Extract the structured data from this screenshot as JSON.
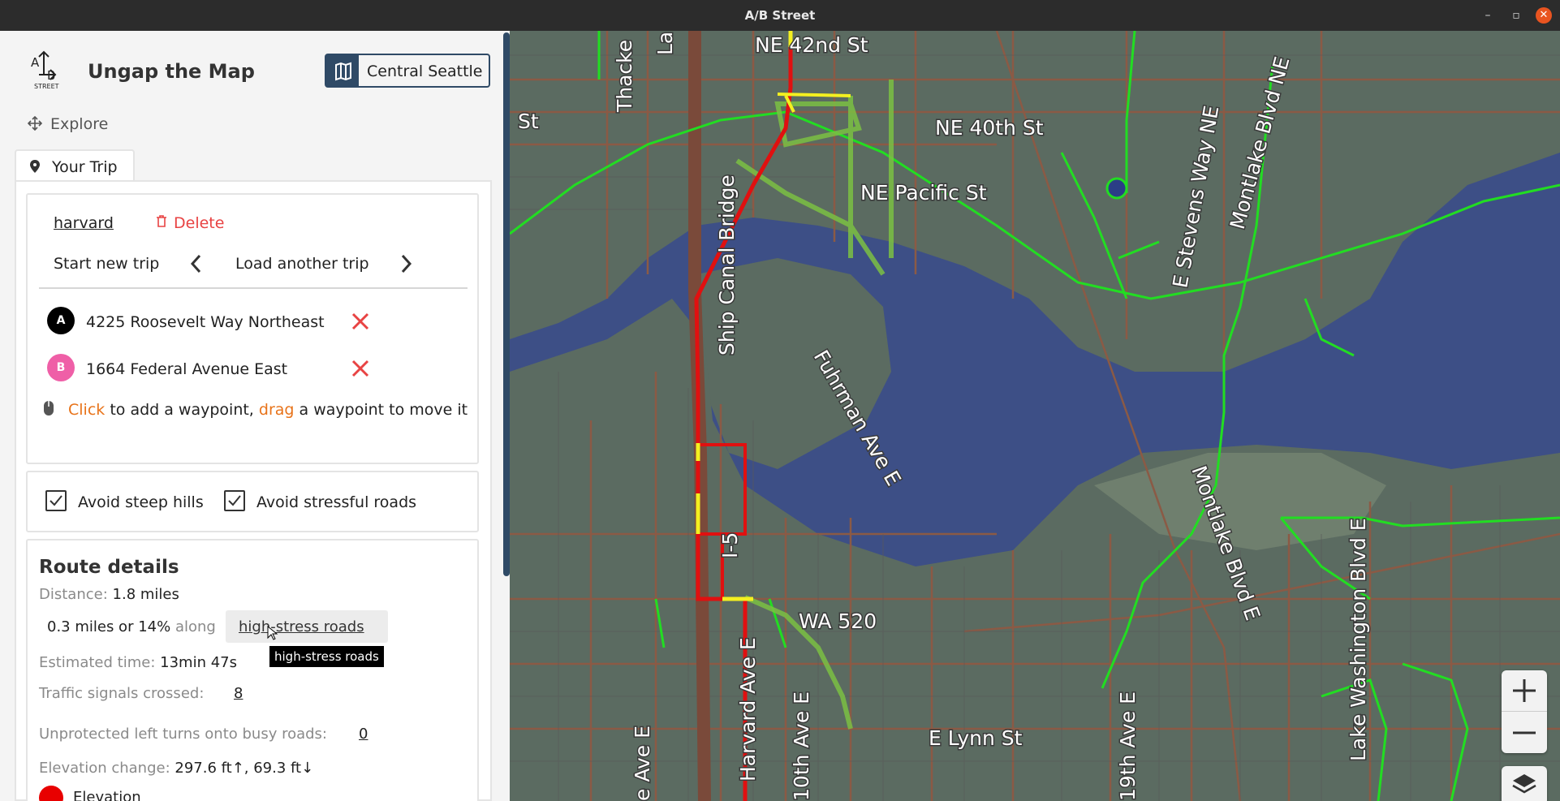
{
  "window": {
    "title": "A/B Street",
    "minimize": "–",
    "restore": "▫",
    "close": "✕"
  },
  "header": {
    "logo_text": "A/B",
    "logo_sub": "STREET",
    "app_name": "Ungap the Map",
    "region_button": "Central Seattle",
    "explore": "Explore",
    "tab_your_trip": "Your Trip"
  },
  "trip": {
    "name": "harvard",
    "delete": "Delete",
    "start_new": "Start new trip",
    "load_another": "Load another trip",
    "waypoints": [
      {
        "badge": "A",
        "label": "4225 Roosevelt Way Northeast",
        "color": "#000000"
      },
      {
        "badge": "B",
        "label": "1664 Federal Avenue East",
        "color": "#ef5fa7"
      }
    ],
    "hint_click": "Click",
    "hint_mid": "to add a waypoint,",
    "hint_drag": "drag",
    "hint_end": "a waypoint to move it"
  },
  "options": {
    "avoid_hills": "Avoid steep hills",
    "avoid_stress": "Avoid stressful roads"
  },
  "route": {
    "title": "Route details",
    "distance_label": "Distance:",
    "distance_value": "1.8 miles",
    "stress_amount": "0.3 miles or 14%",
    "stress_along": "along",
    "stress_link": "high-stress roads",
    "tooltip": "high-stress roads",
    "time_label": "Estimated time:",
    "time_value": "13min 47s",
    "signals_label": "Traffic signals crossed:",
    "signals_value": "8",
    "left_turns_label": "Unprotected left turns onto busy roads:",
    "left_turns_value": "0",
    "elevation_label": "Elevation change:",
    "elevation_value": "297.6 ft↑, 69.3 ft↓",
    "elevation_legend": "Elevation"
  },
  "map_labels": {
    "ne42": "NE 42nd St",
    "ne40": "NE 40th St",
    "pacific": "NE Pacific St",
    "st": "St",
    "thacke": "Thacke",
    "la": "La",
    "ship_canal": "Ship Canal Bridge",
    "stevens": "E Stevens Way NE",
    "montlake_ne": "Montlake Blvd NE",
    "fuhrman": "Fuhrman Ave E",
    "i5": "I-5",
    "montlake_e": "Montlake Blvd E",
    "wa520": "WA 520",
    "lake_wash": "Lake Washington Blvd E",
    "harvard": "Harvard Ave E",
    "tenth": "10th Ave E",
    "e_ave": "e Ave E",
    "nineteenth": "19th Ave E",
    "lynn": "E Lynn St"
  },
  "colors": {
    "panel_bg": "#f4f4f4",
    "accent": "#e8731a",
    "route_red": "#e01010",
    "route_yellow": "#f4f020",
    "bike_green": "#22dd22",
    "water": "#3d4f86",
    "land": "#5b6b61"
  }
}
